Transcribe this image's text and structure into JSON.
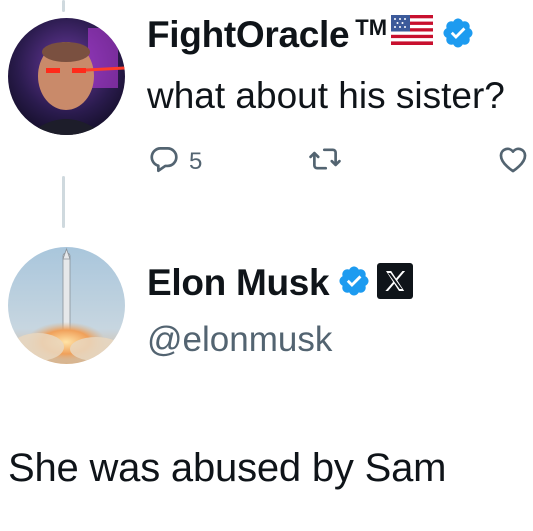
{
  "reply": {
    "author_name": "FightOracle",
    "trademark": "TM",
    "flag_icon": "us-flag-icon",
    "verified_color": "#1d9bf0",
    "text": "what about his sister?",
    "reply_count": "5"
  },
  "tweet": {
    "author_name": "Elon Musk",
    "handle": "@elonmusk",
    "verified_color": "#1d9bf0",
    "affiliate_icon": "x-logo-icon",
    "text": "She was abused by Sam"
  },
  "colors": {
    "text": "#0f1419",
    "secondary": "#536471",
    "thread_line": "#cfd9de"
  }
}
